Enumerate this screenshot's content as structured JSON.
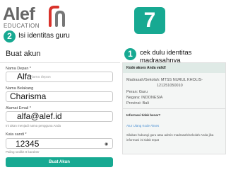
{
  "brand": {
    "name": "Alef",
    "sub": "EDUCATION"
  },
  "step_number": "7",
  "instructions": {
    "left_number": "2",
    "left_text": "Isi identitas guru",
    "right_number": "1",
    "right_text": "cek dulu identitas madrasahnya"
  },
  "form": {
    "title": "Buat akun",
    "first_name": {
      "label": "Nama Depan *",
      "value": "Alfa",
      "placeholder": "Nama depan"
    },
    "last_name": {
      "label": "Nama Belakang",
      "value": "Charisma"
    },
    "email": {
      "label": "Alamat Email *",
      "value": "alfa@alef.id",
      "hint": "Ini akan menjadi nama pengguna Anda"
    },
    "password": {
      "label": "Kata sandi *",
      "value": "12345",
      "hint": "Paling sedikit 8 karakter"
    },
    "submit_label": "Buat Akun"
  },
  "info_card": {
    "title": "Kode akses Anda valid!",
    "madrasah": "Madrasah/Sekolah: MTSS NURUL KHOLIS-",
    "madrasah_cont": "121251050010",
    "role": "Peran: Guru",
    "country": "Negara: INDONESIA",
    "province": "Provinsi: Bali",
    "wrong_info": "Informasi tidak benar?",
    "link": "Atur Ulang Kode Akses",
    "note_1": "Silakan hubungi guru atau admin madrasah/sekolah Anda jika",
    "note_2": "informasi ini tidak tepat"
  },
  "colors": {
    "accent": "#17a992",
    "brand_red": "#d9322b"
  }
}
